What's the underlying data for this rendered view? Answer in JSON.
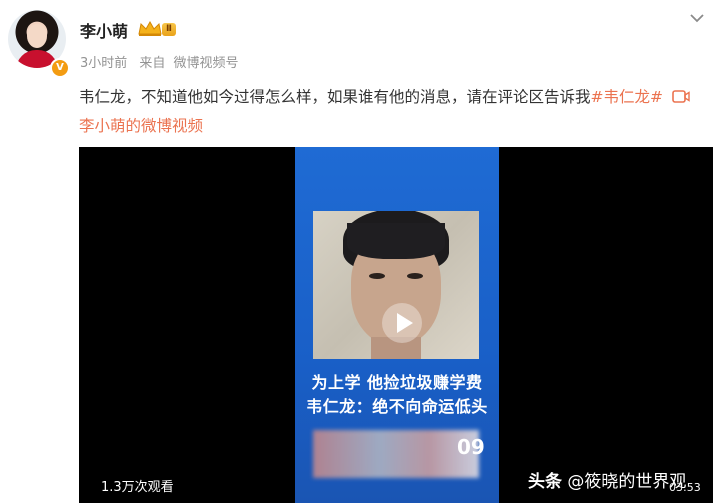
{
  "user": {
    "name": "李小萌",
    "level_badge": "Ⅱ",
    "verified_badge": "V"
  },
  "meta": {
    "time": "3小时前",
    "source_prefix": "来自",
    "source": "微博视频号"
  },
  "post": {
    "text": "韦仁龙，不知道他如今过得怎么样，如果谁有他的消息，请在评论区告诉我",
    "hashtag": "#韦仁龙#",
    "video_link": "李小萌的微博视频"
  },
  "video": {
    "caption_line1": "为上学 他捡垃圾赚学费",
    "caption_line2": "韦仁龙：绝不向命运低头",
    "blurred_number": "09",
    "views": "1.3万次观看",
    "duration": "03:53"
  },
  "watermark": {
    "site": "头条",
    "account": "@筱晓的世界观"
  },
  "colors": {
    "accent": "#eb7350",
    "video_bg": "#000000",
    "video_inner": "#1f6bd4",
    "meta_gray": "#939393"
  },
  "icons": [
    "crown-icon",
    "chevron-down-icon",
    "video-link-icon",
    "play-icon"
  ]
}
